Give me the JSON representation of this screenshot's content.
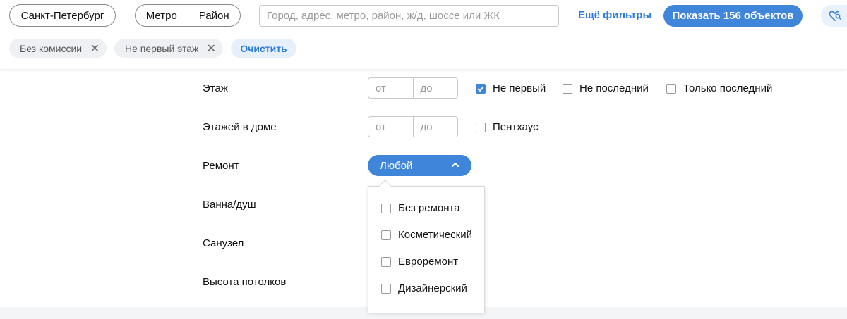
{
  "topbar": {
    "city": "Санкт-Петербург",
    "metro": "Метро",
    "district": "Район",
    "search_placeholder": "Город, адрес, метро, район, ж/д, шоссе или ЖК",
    "more_filters": "Ещё фильтры",
    "show_button": "Показать 156 объектов",
    "favorite_icon": "heart-search-icon"
  },
  "chips": [
    {
      "label": "Без комиссии"
    },
    {
      "label": "Не первый этаж"
    }
  ],
  "clear_label": "Очистить",
  "filters": {
    "floor": {
      "label": "Этаж",
      "from_placeholder": "от",
      "to_placeholder": "до",
      "options": [
        {
          "label": "Не первый",
          "checked": true
        },
        {
          "label": "Не последний",
          "checked": false
        },
        {
          "label": "Только последний",
          "checked": false
        }
      ]
    },
    "floors_in_building": {
      "label": "Этажей в доме",
      "from_placeholder": "от",
      "to_placeholder": "до",
      "penthouse": {
        "label": "Пентхаус",
        "checked": false
      }
    },
    "renovation": {
      "label": "Ремонт",
      "selected": "Любой",
      "options": [
        {
          "label": "Без ремонта",
          "checked": false
        },
        {
          "label": "Косметический",
          "checked": false
        },
        {
          "label": "Евроремонт",
          "checked": false
        },
        {
          "label": "Дизайнерский",
          "checked": false
        }
      ]
    },
    "bath": {
      "label": "Ванна/душ"
    },
    "bathroom": {
      "label": "Санузел"
    },
    "ceiling": {
      "label": "Высота потолков"
    }
  },
  "colors": {
    "accent": "#3f85d9",
    "link": "#2b7bd9"
  }
}
